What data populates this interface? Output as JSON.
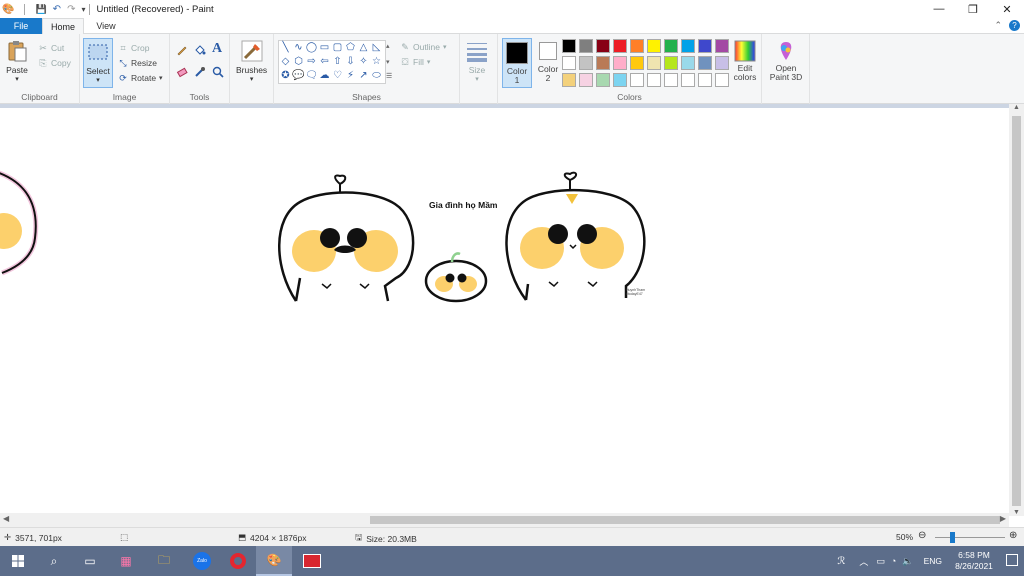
{
  "window": {
    "title": "Untitled (Recovered) - Paint",
    "minimize": "—",
    "restore": "❐",
    "close": "✕"
  },
  "quick_access": {
    "save": "💾",
    "undo": "↶",
    "redo": "↷",
    "customize": "▾"
  },
  "tabs": {
    "file": "File",
    "home": "Home",
    "view": "View",
    "collapse": "⌃",
    "help": "?"
  },
  "ribbon": {
    "clipboard": {
      "label": "Clipboard",
      "paste": "Paste",
      "cut": "Cut",
      "copy": "Copy"
    },
    "image": {
      "label": "Image",
      "select": "Select",
      "crop": "Crop",
      "resize": "Resize",
      "rotate": "Rotate"
    },
    "tools": {
      "label": "Tools",
      "text_tool": "A"
    },
    "brushes": {
      "label": "Brushes"
    },
    "shapes": {
      "label": "Shapes",
      "outline": "Outline",
      "fill": "Fill",
      "items": [
        "╲",
        "∿",
        "◯",
        "▭",
        "▢",
        "⬠",
        "△",
        "◺",
        "◇",
        "⬡",
        "⇨",
        "⇦",
        "⇧",
        "⇩",
        "✧",
        "☆",
        "✪",
        "💬",
        "🗨",
        "☁",
        "♡",
        "⚡",
        "↗",
        "⬭"
      ]
    },
    "size": {
      "label": "Size"
    },
    "colors": {
      "label": "Colors",
      "color1": "Color 1",
      "color2": "Color 2",
      "color1_value": "#000000",
      "color2_value": "#ffffff",
      "edit_colors": "Edit colors",
      "open_paint3d": "Open Paint 3D",
      "palette": [
        "#000000",
        "#7f7f7f",
        "#880015",
        "#ed1c24",
        "#ff7f27",
        "#fff200",
        "#22b14c",
        "#00a2e8",
        "#3f48cc",
        "#a349a4",
        "#ffffff",
        "#c3c3c3",
        "#b97a57",
        "#ffaec9",
        "#ffc90e",
        "#efe4b0",
        "#b5e61d",
        "#99d9ea",
        "#7092be",
        "#c8bfe7",
        "#f3d17c",
        "#f6d2e3",
        "#a8d8b0",
        "#7dd4f0",
        "#ffffff",
        "#ffffff",
        "#ffffff",
        "#ffffff",
        "#ffffff",
        "#ffffff"
      ]
    }
  },
  "drawing": {
    "caption": "Gia đình họ Mầm",
    "signature_line1": "HuynhTham",
    "signature_line2": "#todayE47"
  },
  "status": {
    "cursor_position": "3571, 701px",
    "image_size": "4204 × 1876px",
    "file_size": "Size: 20.3MB",
    "zoom": "50%"
  },
  "taskbar": {
    "apps": [
      "windows-start",
      "search",
      "task-view",
      "store",
      "file-explorer",
      "zalo",
      "opera",
      "paint",
      "mspaint-red"
    ],
    "zalo_label": "Zalo",
    "lang": "ENG",
    "time": "6:58 PM",
    "date": "8/26/2021"
  }
}
